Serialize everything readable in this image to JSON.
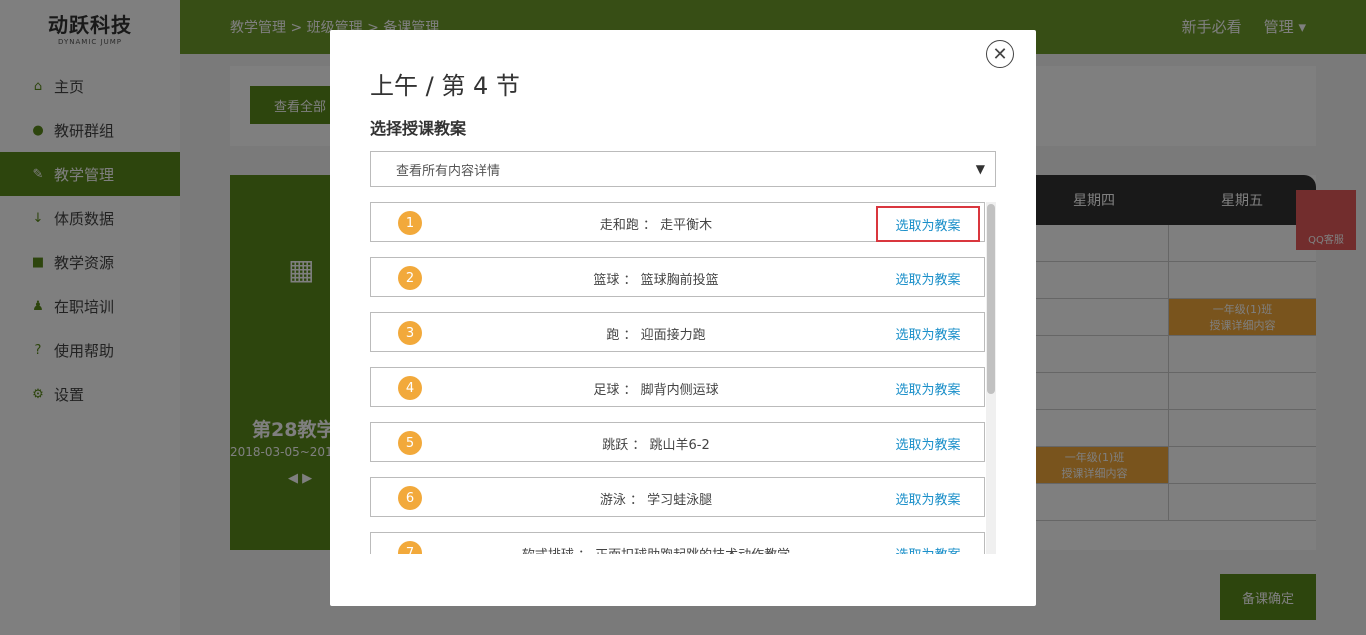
{
  "logo": {
    "main": "动跃科技",
    "sub": "DYNAMIC JUMP"
  },
  "sidebar": {
    "items": [
      {
        "label": "主页",
        "icon": "home-icon"
      },
      {
        "label": "教研群组",
        "icon": "group-icon"
      },
      {
        "label": "教学管理",
        "icon": "edit-icon"
      },
      {
        "label": "体质数据",
        "icon": "data-icon"
      },
      {
        "label": "教学资源",
        "icon": "resource-icon"
      },
      {
        "label": "在职培训",
        "icon": "training-icon"
      },
      {
        "label": "使用帮助",
        "icon": "help-icon"
      },
      {
        "label": "设置",
        "icon": "gear-icon"
      }
    ]
  },
  "topbar": {
    "breadcrumb": "教学管理 > 班级管理 > 备课管理",
    "guide": "新手必看",
    "manage": "管理"
  },
  "toolbar": {
    "view_all": "查看全部"
  },
  "week": {
    "title": "第28教学",
    "range": "2018-03-05~201"
  },
  "grid": {
    "headers": [
      "星期四",
      "星期五"
    ],
    "cell_text": [
      "一年级(1)班",
      "授课详细内容"
    ]
  },
  "qq": {
    "label": "QQ客服"
  },
  "bottom": {
    "confirm": "备课确定"
  },
  "modal": {
    "title": "上午 / 第 4 节",
    "subtitle": "选择授课教案",
    "select_value": "查看所有内容详情",
    "action_label": "选取为教案",
    "items": [
      {
        "num": "1",
        "text": "走和跑 ： 走平衡木"
      },
      {
        "num": "2",
        "text": "篮球 ： 篮球胸前投篮"
      },
      {
        "num": "3",
        "text": "跑 ： 迎面接力跑"
      },
      {
        "num": "4",
        "text": "足球 ： 脚背内侧运球"
      },
      {
        "num": "5",
        "text": "跳跃 ： 跳山羊6-2"
      },
      {
        "num": "6",
        "text": "游泳 ： 学习蛙泳腿"
      },
      {
        "num": "7",
        "text": "软式排球 ： 正面扣球助跑起跳的技术动作教学"
      }
    ]
  }
}
